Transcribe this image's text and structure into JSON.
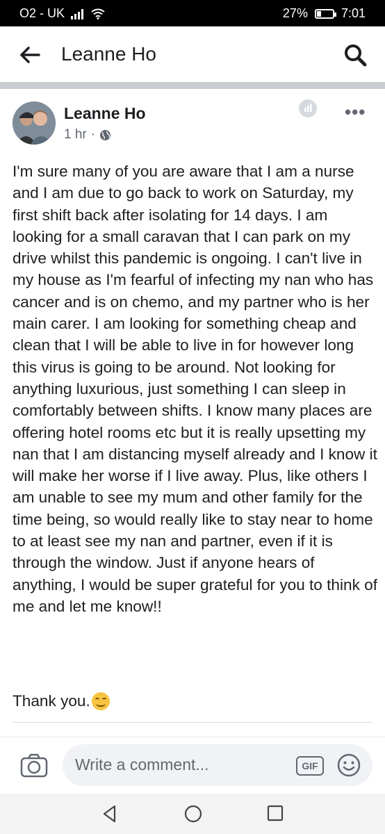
{
  "status_bar": {
    "carrier": "O2 - UK",
    "battery_percent_label": "27%",
    "battery_level": 0.27,
    "time": "7:01"
  },
  "header": {
    "title": "Leanne Ho",
    "icons": [
      "back-arrow-icon",
      "search-icon"
    ]
  },
  "post": {
    "author": "Leanne Ho",
    "time": "1 hr",
    "separator": "·",
    "privacy_icon": "globe-icon",
    "body_paragraphs": [
      "I'm sure many of you are aware that I am a nurse and I am due to go back to work on Saturday, my first shift back after isolating for 14 days. I am looking for a small caravan that I can park on my drive whilst this pandemic is ongoing. I can't live in my house as I'm fearful of infecting my nan who has cancer and is on chemo, and my partner who is her main carer. I am looking for something cheap and clean that I will be able to live in for however long this virus is going to be around. Not looking for anything luxurious, just something I can sleep in comfortably between shifts. I know many places are offering hotel rooms etc but it is really upsetting my nan that I am distancing myself already and I know it will make her worse if I live away. Plus, like others I am unable to see my mum and other family for the time being, so would really like to stay near to home to at least see my nan and partner, even if it is through the window. Just if anyone hears of anything, I would be super grateful for you to think of me and let me know!!"
    ],
    "closing": "Thank you.",
    "closing_emoji": "smiling-face-icon",
    "more_label": "•••"
  },
  "comment_bar": {
    "placeholder": "Write a comment...",
    "gif_label": "GIF"
  },
  "colors": {
    "divider_band": "#c9ccd1",
    "input_bg": "#f0f2f5",
    "secondary_text": "#606770"
  }
}
